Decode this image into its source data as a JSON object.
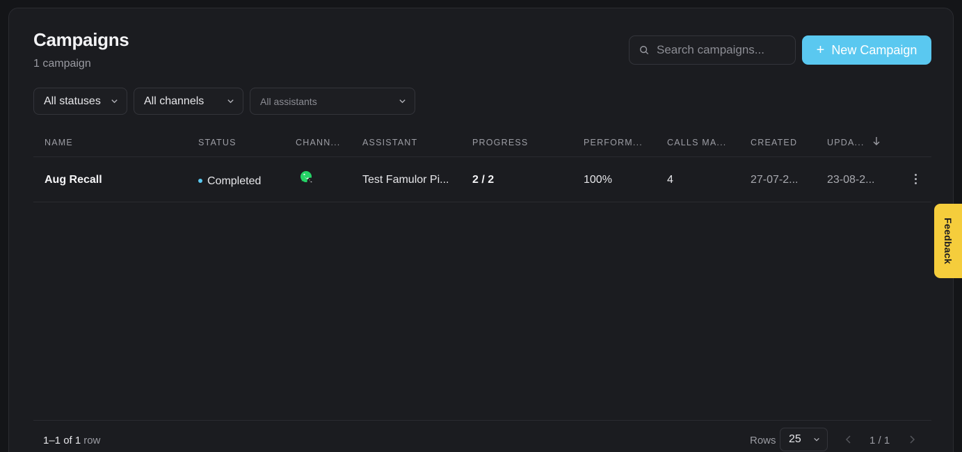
{
  "header": {
    "title": "Campaigns",
    "subtitle": "1 campaign"
  },
  "search": {
    "placeholder": "Search campaigns..."
  },
  "new_button": {
    "label": "New Campaign"
  },
  "filters": {
    "status": "All statuses",
    "channel": "All channels",
    "assistant": "All assistants"
  },
  "table": {
    "columns": [
      "NAME",
      "STATUS",
      "CHANN...",
      "ASSISTANT",
      "PROGRESS",
      "PERFORM...",
      "CALLS MA...",
      "CREATED",
      "UPDA..."
    ],
    "rows": [
      {
        "name": "Aug Recall",
        "status": "Completed",
        "channel_icon": "whatsapp-phone-icon",
        "assistant": "Test Famulor Pi...",
        "progress": "2 / 2",
        "performance": "100%",
        "calls_made": "4",
        "created": "27-07-2...",
        "updated": "23-08-2..."
      }
    ]
  },
  "footer": {
    "range": "1–1 of 1",
    "range_label": "row",
    "rows_label": "Rows",
    "rows_per_page": "25",
    "page": "1 / 1"
  },
  "feedback": {
    "label": "Feedback"
  },
  "colors": {
    "accent": "#5ac8f0",
    "feedback": "#f5cd3c",
    "whatsapp": "#25d366",
    "background": "#1b1c20"
  }
}
